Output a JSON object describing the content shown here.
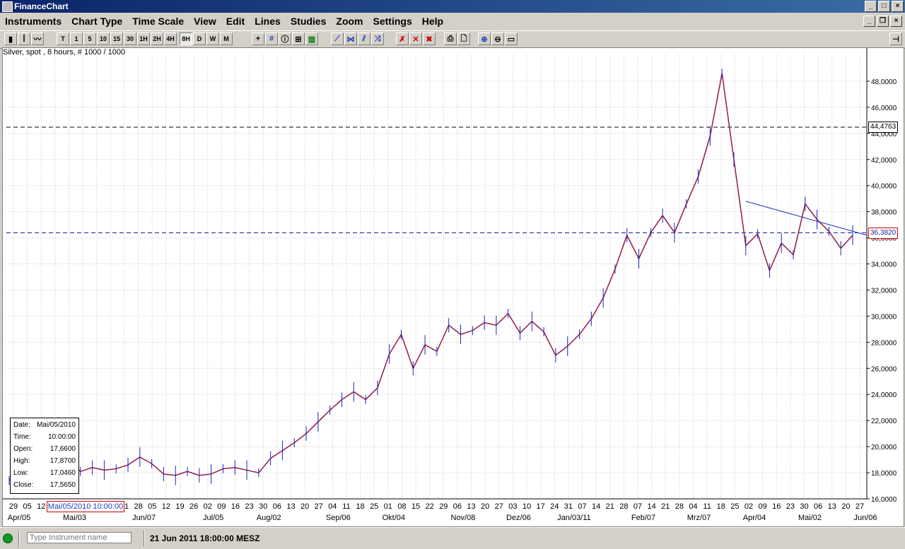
{
  "window": {
    "title": "FinanceChart"
  },
  "menu": [
    "Instruments",
    "Chart Type",
    "Time Scale",
    "View",
    "Edit",
    "Lines",
    "Studies",
    "Zoom",
    "Settings",
    "Help"
  ],
  "toolbar": {
    "timescale": [
      "T",
      "1",
      "5",
      "10",
      "15",
      "30",
      "1H",
      "2H",
      "4H",
      "8H",
      "D",
      "W",
      "M"
    ],
    "active_timescale": "8H"
  },
  "chart": {
    "caption": "Silver, spot , 8 hours, # 1000 / 1000",
    "hlines": [
      {
        "label": "44,4763",
        "value": 44.4763,
        "color": "#000000"
      },
      {
        "label": "36,3820",
        "value": 36.382,
        "color": "#1a1aa0"
      }
    ],
    "infobox": [
      {
        "k": "Date:",
        "v": "Mai/05/2010"
      },
      {
        "k": "Time:",
        "v": "10:00:00"
      },
      {
        "k": "Open:",
        "v": "17,6600"
      },
      {
        "k": "High:",
        "v": "17,8700"
      },
      {
        "k": "Low:",
        "v": "17,0460"
      },
      {
        "k": "Close:",
        "v": "17,5650"
      }
    ],
    "cursor_label": "Mai/05/2010 10:00:00"
  },
  "chart_data": {
    "type": "line",
    "title": "Silver, spot , 8 hours, # 1000 / 1000",
    "xlabel": "",
    "ylabel": "",
    "ylim": [
      16,
      50
    ],
    "y_ticks": [
      "16,0000",
      "18,0000",
      "20,0000",
      "22,0000",
      "24,0000",
      "26,0000",
      "28,0000",
      "30,0000",
      "32,0000",
      "34,0000",
      "36,0000",
      "38,0000",
      "40,0000",
      "42,0000",
      "44,0000",
      "46,0000",
      "48,0000"
    ],
    "x_ticks": [
      "29",
      "05",
      "12",
      "19",
      "26",
      "31",
      "07",
      "14",
      "21",
      "28",
      "05",
      "12",
      "19",
      "26",
      "02",
      "09",
      "16",
      "23",
      "30",
      "06",
      "13",
      "20",
      "27",
      "04",
      "11",
      "18",
      "25",
      "01",
      "08",
      "15",
      "22",
      "29",
      "06",
      "13",
      "20",
      "27",
      "03",
      "10",
      "17",
      "24",
      "31",
      "07",
      "14",
      "21",
      "28",
      "07",
      "14",
      "21",
      "28",
      "04",
      "11",
      "18",
      "25",
      "02",
      "09",
      "16",
      "23",
      "30",
      "06",
      "13",
      "20",
      "27"
    ],
    "x_months": [
      "Apr/05",
      "Mai/03",
      "Jun/07",
      "Jul/05",
      "Aug/02",
      "Sep/06",
      "Okt/04",
      "Nov/08",
      "Dez/06",
      "Jan/03/11",
      "Feb/07",
      "Mrz/07",
      "Apr/04",
      "Mai/02",
      "Jun/06"
    ],
    "grid": true,
    "series": [
      {
        "name": "",
        "values": [
          17.4,
          18.6,
          17.8,
          18.9,
          19.6,
          18.9,
          18.1,
          18.4,
          18.2,
          18.3,
          18.6,
          19.2,
          18.7,
          17.9,
          17.8,
          18.1,
          17.8,
          17.9,
          18.3,
          18.4,
          18.2,
          18.0,
          19.1,
          19.7,
          20.3,
          21.0,
          21.9,
          22.8,
          23.6,
          24.2,
          23.6,
          24.5,
          27.1,
          28.6,
          26.0,
          27.8,
          27.3,
          29.3,
          28.6,
          28.9,
          29.5,
          29.3,
          30.2,
          28.7,
          29.6,
          28.8,
          27.0,
          27.7,
          28.6,
          29.8,
          31.4,
          33.6,
          36.2,
          34.4,
          36.4,
          37.7,
          36.4,
          38.6,
          40.7,
          43.8,
          48.6,
          42.0,
          35.4,
          36.3,
          33.5,
          35.6,
          34.7,
          38.6,
          37.4,
          36.5,
          35.2,
          36.2
        ]
      }
    ]
  },
  "statusbar": {
    "instrument_placeholder": "Type Instrument name",
    "datetime": "21 Jun 2011 18:00:00 MESZ"
  }
}
